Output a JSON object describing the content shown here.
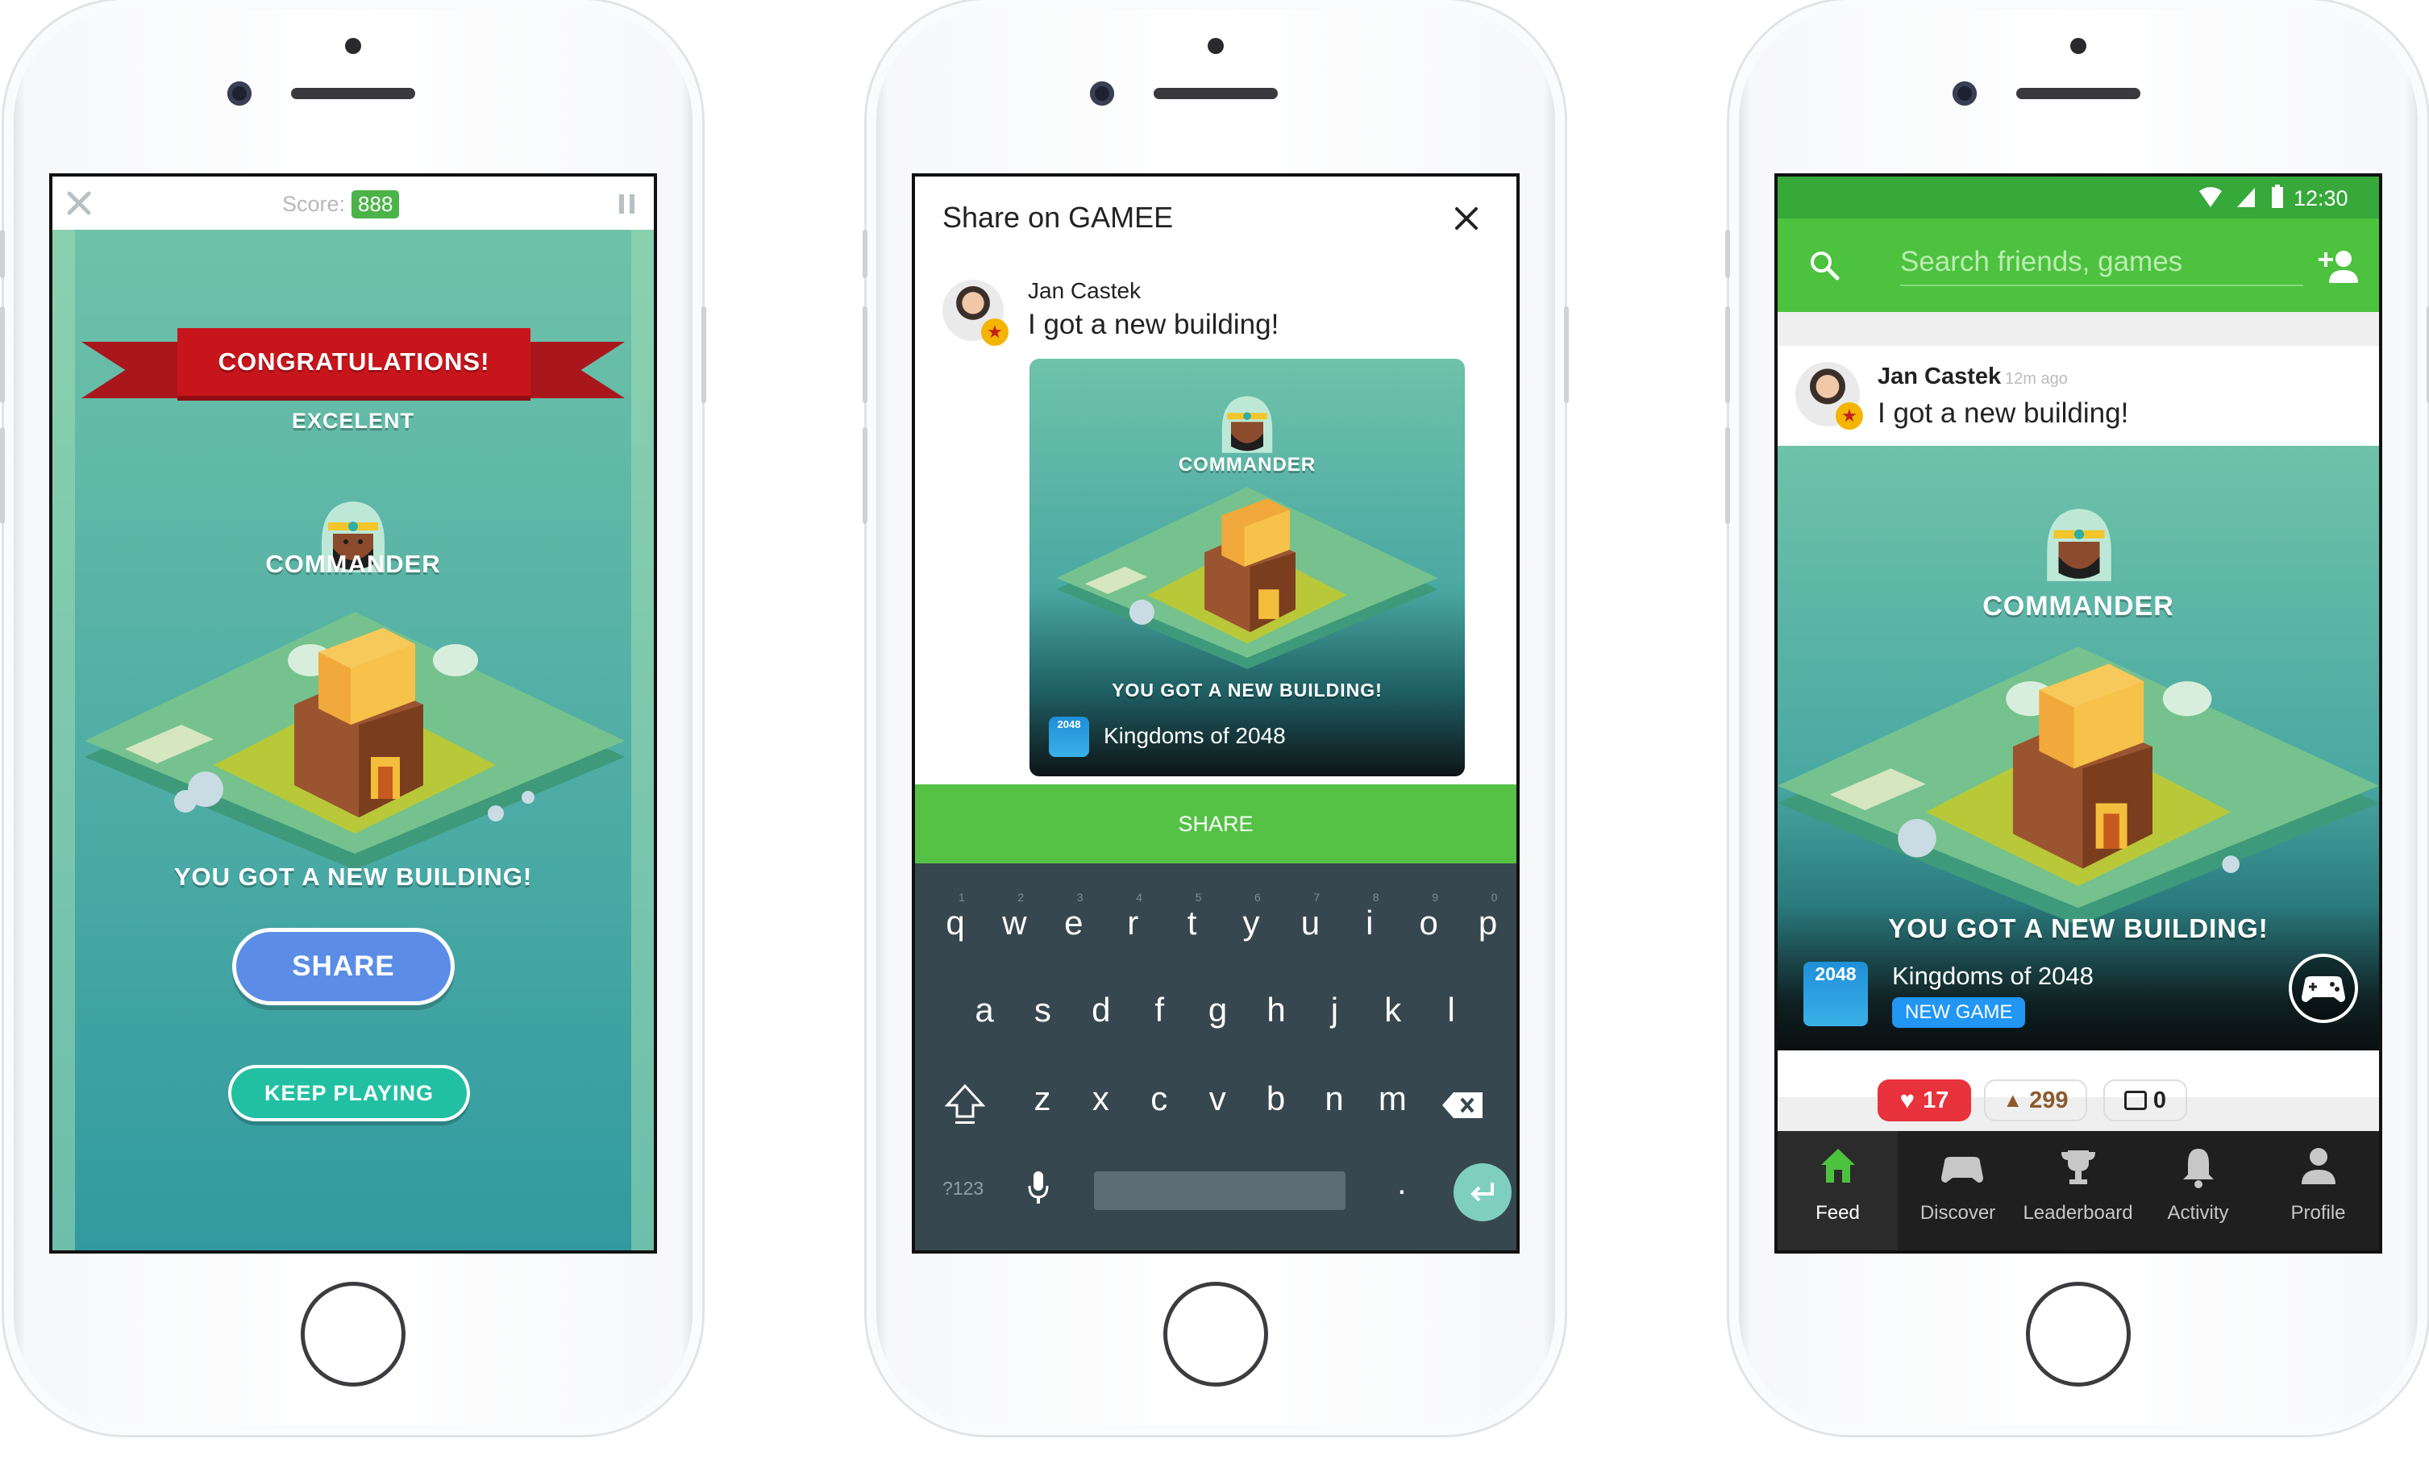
{
  "phone1": {
    "score_label": "Score:",
    "score_value": "888",
    "banner": "CONGRATULATIONS!",
    "rating": "EXCELENT",
    "rank": "COMMANDER",
    "message": "YOU GOT A NEW BUILDING!",
    "share_label": "SHARE",
    "keep_playing_label": "KEEP PLAYING"
  },
  "phone2": {
    "title": "Share on GAMEE",
    "user_name": "Jan Castek",
    "post_text": "I got a new building!",
    "card_rank": "COMMANDER",
    "card_message": "YOU GOT A NEW BUILDING!",
    "game_icon_text": "2048",
    "game_name": "Kingdoms of 2048",
    "share_label": "SHARE",
    "keyboard": {
      "row1": [
        "q",
        "w",
        "e",
        "r",
        "t",
        "y",
        "u",
        "i",
        "o",
        "p"
      ],
      "row1_nums": [
        "1",
        "2",
        "3",
        "4",
        "5",
        "6",
        "7",
        "8",
        "9",
        "0"
      ],
      "row2": [
        "a",
        "s",
        "d",
        "f",
        "g",
        "h",
        "j",
        "k",
        "l"
      ],
      "row3": [
        "z",
        "x",
        "c",
        "v",
        "b",
        "n",
        "m"
      ],
      "symbols_label": "?123",
      "period": "."
    }
  },
  "phone3": {
    "time": "12:30",
    "search_placeholder": "Search friends, games",
    "user_name": "Jan Castek",
    "time_ago": "12m ago",
    "post_text": "I got a new building!",
    "card_rank": "COMMANDER",
    "card_message": "YOU GOT A NEW BUILDING!",
    "game_icon_text": "2048",
    "game_name": "Kingdoms of 2048",
    "new_game_badge": "NEW GAME",
    "likes": "17",
    "poops": "299",
    "comments": "0",
    "nav": [
      "Feed",
      "Discover",
      "Leaderboard",
      "Activity",
      "Profile"
    ]
  },
  "colors": {
    "gamee_green": "#4cc23f",
    "share_blue": "#5b8de6",
    "keep_teal": "#22c0a2",
    "ribbon_red": "#c8151c",
    "like_red": "#e8323c",
    "poop_brown": "#8b5a2b",
    "badge_blue": "#2196f3"
  }
}
